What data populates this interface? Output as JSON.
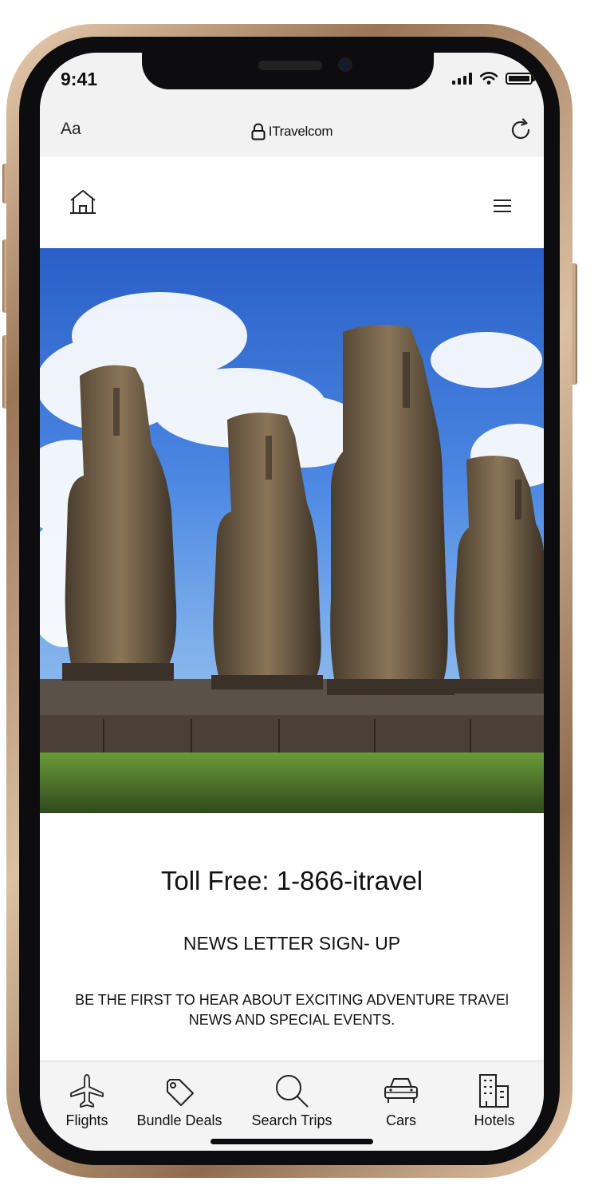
{
  "status_bar": {
    "time": "9:41"
  },
  "browser": {
    "reader_label": "Aa",
    "url": "ITravelcom"
  },
  "nav": {
    "home_icon": "home-icon",
    "menu_icon": "hamburger-menu-icon"
  },
  "hero": {
    "subject": "moai-statues-photo"
  },
  "content": {
    "toll_free": "Toll Free: 1-866-itravel",
    "newsletter_title": "NEWS LETTER SIGN- UP",
    "newsletter_line1": "BE THE FIRST TO HEAR ABOUT EXCITING ADVENTURE TRAVEl",
    "newsletter_line2": "NEWS AND SPECIAL EVENTS."
  },
  "tabbar": {
    "items": [
      {
        "label": "Flights",
        "icon": "airplane-icon"
      },
      {
        "label": "Bundle Deals",
        "icon": "tag-icon"
      },
      {
        "label": "Search Trips",
        "icon": "search-icon"
      },
      {
        "label": "Cars",
        "icon": "car-icon"
      },
      {
        "label": "Hotels",
        "icon": "building-icon"
      }
    ]
  },
  "colors": {
    "sky": "#3b78d8",
    "frame_gold": "#c9a684",
    "bezel": "#0d0d0f",
    "browser_bg": "#f2f2f2"
  }
}
